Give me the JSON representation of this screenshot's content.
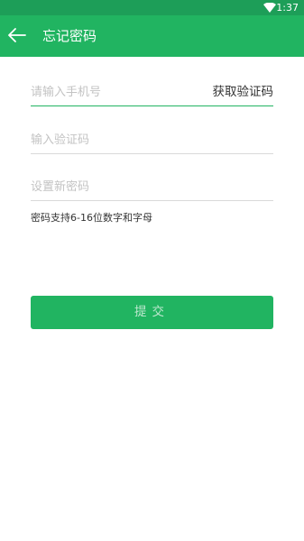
{
  "status_bar": {
    "time": "1:37",
    "icons": [
      "wifi-icon"
    ]
  },
  "app_bar": {
    "back_icon": "back-arrow-icon",
    "title": "忘记密码"
  },
  "form": {
    "phone_placeholder": "请输入手机号",
    "get_code_label": "获取验证码",
    "code_placeholder": "输入验证码",
    "password_placeholder": "设置新密码",
    "password_hint": "密码支持6-16位数字和字母",
    "submit_label": "提交"
  },
  "colors": {
    "status_bar": "#1d9e58",
    "app_bar": "#21b461",
    "accent": "#21b461",
    "submit_text": "#bfe8d0"
  }
}
